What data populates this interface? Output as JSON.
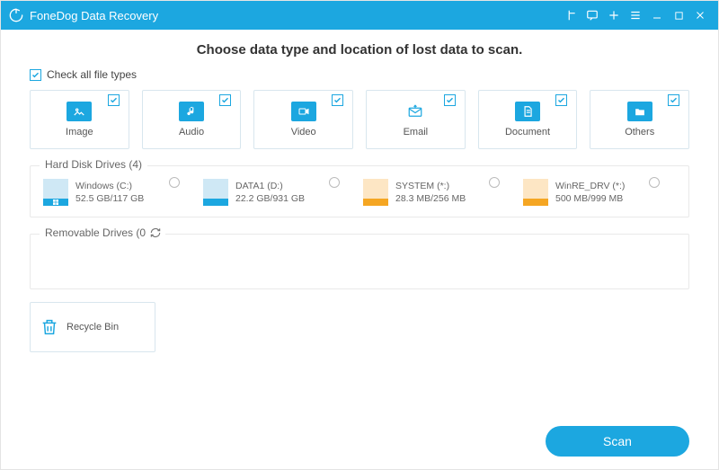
{
  "app": {
    "title": "FoneDog Data Recovery"
  },
  "heading": "Choose data type and location of lost data to scan.",
  "check_all_label": "Check all file types",
  "types": [
    {
      "label": "Image"
    },
    {
      "label": "Audio"
    },
    {
      "label": "Video"
    },
    {
      "label": "Email"
    },
    {
      "label": "Document"
    },
    {
      "label": "Others"
    }
  ],
  "hdd": {
    "legend": "Hard Disk Drives (4)",
    "items": [
      {
        "name": "Windows (C:)",
        "size": "52.5 GB/117 GB",
        "fill_color": "#1ca7e0",
        "bg_color": "#cfe8f5"
      },
      {
        "name": "DATA1 (D:)",
        "size": "22.2 GB/931 GB",
        "fill_color": "#1ca7e0",
        "bg_color": "#cfe8f5"
      },
      {
        "name": "SYSTEM (*:)",
        "size": "28.3 MB/256 MB",
        "fill_color": "#f5a623",
        "bg_color": "#fde6c4"
      },
      {
        "name": "WinRE_DRV (*:)",
        "size": "500 MB/999 MB",
        "fill_color": "#f5a623",
        "bg_color": "#fde6c4"
      }
    ]
  },
  "removable": {
    "legend": "Removable Drives (0)"
  },
  "recycle": {
    "label": "Recycle Bin",
    "selected": true
  },
  "scan_label": "Scan"
}
